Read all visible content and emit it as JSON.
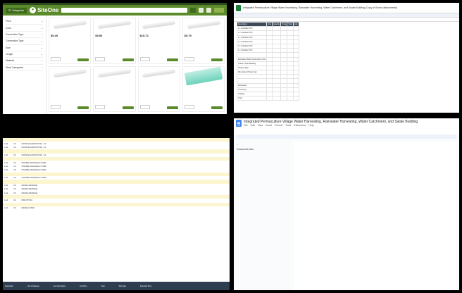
{
  "siteone": {
    "promo": "",
    "categories_label": "Categories",
    "logo_text": "SiteOne",
    "filters": [
      "Price",
      "Color",
      "Connection Type",
      "Connection Type",
      "Size",
      "Length",
      "Material",
      "More Categories"
    ],
    "products": [
      {
        "name": "",
        "price": "$5.49",
        "type": "pipe"
      },
      {
        "name": "",
        "price": "$9.50",
        "type": "pipe"
      },
      {
        "name": "",
        "price": "$15.72",
        "type": "pipe"
      },
      {
        "name": "",
        "price": "$5.79",
        "type": "pipe"
      },
      {
        "name": "",
        "price": "",
        "type": "pipe"
      },
      {
        "name": "",
        "price": "",
        "type": "pipe"
      },
      {
        "name": "",
        "price": "",
        "type": "pipe"
      },
      {
        "name": "",
        "price": "",
        "type": "green"
      }
    ]
  },
  "sheet": {
    "title": "Integrated Permaculture Village Water Harvesting, Rainwater Harvesting, Water Catchment, and Swale Building (Copy of Saved attachments)",
    "columns": [
      "Description",
      "Unit",
      "Quantity",
      "Price",
      "Total",
      "Link"
    ],
    "rows": [
      [
        "1 x schedule PVC",
        "",
        "",
        "",
        "",
        ""
      ],
      [
        "1 x schedule PVC",
        "",
        "",
        "",
        "",
        ""
      ],
      [
        "1 x schedule PVC",
        "",
        "",
        "",
        "",
        ""
      ],
      [
        "1 x schedule PVC",
        "",
        "",
        "",
        "",
        ""
      ],
      [
        "1 x schedule PVC",
        "",
        "",
        "",
        "",
        ""
      ],
      [
        "1 x schedule PVC",
        "",
        "",
        "",
        "",
        ""
      ],
      [
        "",
        "",
        "",
        "",
        "",
        ""
      ],
      [
        "Estimated Total Construction Cost",
        "",
        "",
        "",
        "",
        ""
      ],
      [
        "Gravel / Pipe Bedding",
        "",
        "",
        "",
        "",
        ""
      ],
      [
        "Sealing Tape",
        "",
        "",
        "",
        "",
        ""
      ],
      [
        "Pipe Glue / Primer Can",
        "",
        "",
        "",
        "",
        ""
      ],
      [
        "",
        "",
        "",
        "",
        "",
        ""
      ],
      [
        "",
        "",
        "",
        "",
        "",
        ""
      ],
      [
        "Excavation",
        "",
        "",
        "",
        "",
        ""
      ],
      [
        "Trenching",
        "",
        "",
        "",
        "",
        ""
      ],
      [
        "Grading",
        "",
        "",
        "",
        "",
        ""
      ],
      [
        "Total",
        "",
        "",
        "",
        "",
        ""
      ]
    ]
  },
  "report": {
    "sections": [
      {
        "header": "",
        "rows": [
          [
            "1 EA",
            "CS",
            "CROSS EXCAVATION HDL - 8 A",
            "",
            "",
            "",
            ""
          ],
          [
            "1 EA",
            "CS",
            "CROSS EXCAVATION HDL - 8 A",
            "",
            "",
            "",
            ""
          ]
        ]
      },
      {
        "header": "",
        "rows": [
          [
            "1 EA",
            "CS",
            "CROSS EXCAVATION HDL - 8 A",
            "",
            "",
            "",
            ""
          ]
        ]
      },
      {
        "header": "",
        "rows": [
          [
            "1 EA",
            "CS",
            "CHANNEL DRAINAGE SYSTEM",
            "",
            "",
            "",
            ""
          ],
          [
            "1 EA",
            "CS",
            "CHANNEL DRAINAGE SYSTEM",
            "",
            "",
            "",
            ""
          ],
          [
            "1 EA",
            "CS",
            "CHANNEL DRAINAGE SYSTEM",
            "",
            "",
            "",
            ""
          ]
        ]
      },
      {
        "header": "",
        "rows": [
          [
            "1 EA",
            "CS",
            "CHANNEL DRAINAGE SYSTEM",
            "",
            "",
            "",
            ""
          ]
        ]
      },
      {
        "header": "",
        "rows": [
          [
            "1 EA",
            "CS",
            "GRAVEL DRAINAGE",
            "",
            "",
            "",
            ""
          ],
          [
            "1 EA",
            "CS",
            "GRAVEL DRAINAGE",
            "",
            "",
            "",
            ""
          ],
          [
            "1 EA",
            "CS",
            "GRAVEL DRAINAGE",
            "",
            "",
            "",
            ""
          ]
        ]
      },
      {
        "header": "",
        "rows": [
          [
            "1 EA",
            "CS",
            "PIPE FITTING",
            "",
            "",
            "",
            ""
          ]
        ]
      },
      {
        "header": "",
        "rows": [
          [
            "1 EA",
            "CS",
            "GRAVEL FILTER",
            "",
            "",
            "",
            ""
          ]
        ]
      }
    ],
    "footer": [
      "Description",
      "Unit of Measure",
      "Item Description",
      "Unit Price",
      "Total",
      "Ship Date",
      "Extended Price"
    ]
  },
  "doc": {
    "title": "Integrated Permaculture Village Water Harvesting, Rainwater Harvesting, Water Catchment, and Swale Building",
    "menu": [
      "File",
      "Edit",
      "View",
      "Insert",
      "Format",
      "Tools",
      "Extensions",
      "Help"
    ],
    "tabs_label": "Document tabs",
    "tabs": [
      "",
      "",
      "",
      "",
      "",
      "",
      "",
      "",
      "",
      "",
      "",
      "",
      "",
      "",
      "",
      "",
      "",
      "",
      "",
      "",
      "",
      ""
    ],
    "paragraphs": [
      {
        "text": "",
        "cls": "gd-p"
      },
      {
        "text": "",
        "cls": "gd-p"
      },
      {
        "text": "",
        "cls": "gd-p"
      },
      {
        "text": "",
        "cls": "gd-p gd-center"
      },
      {
        "text": "",
        "cls": "gd-p gd-red"
      },
      {
        "text": "",
        "cls": "gd-p gd-bold gd-red"
      },
      {
        "text": "",
        "cls": "gd-p"
      },
      {
        "text": "",
        "cls": "gd-p gd-red"
      },
      {
        "text": "",
        "cls": "gd-p gd-center"
      },
      {
        "text": "",
        "cls": "gd-p"
      },
      {
        "text": "",
        "cls": "gd-p gd-red"
      },
      {
        "text": "",
        "cls": "gd-p gd-center"
      },
      {
        "text": "",
        "cls": "gd-p"
      }
    ]
  },
  "colors": {
    "siteone_green": "#5a8a2a",
    "sheet_header": "#3c4a5a",
    "report_band": "#fcf6d0",
    "doc_red": "#c5221f"
  }
}
